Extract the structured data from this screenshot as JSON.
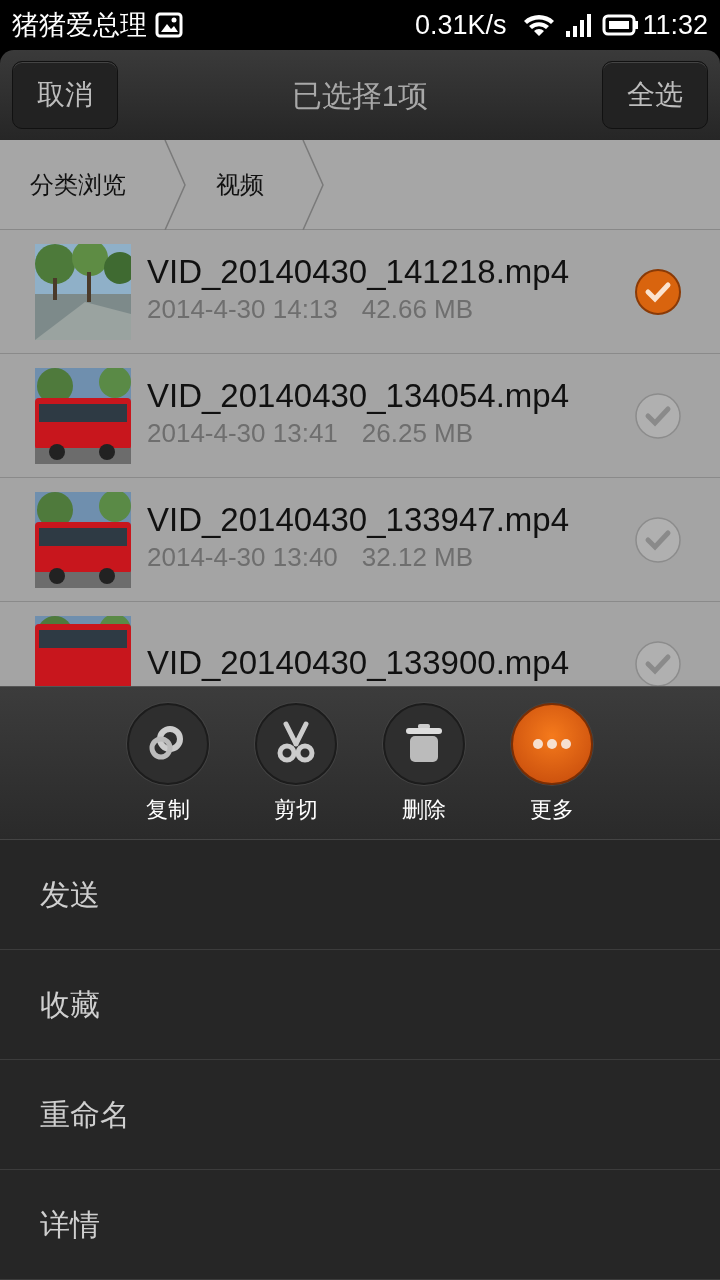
{
  "status_bar": {
    "app_name": "猪猪爱总理",
    "speed": "0.31K/s",
    "time": "11:32"
  },
  "title_bar": {
    "cancel": "取消",
    "title": "已选择1项",
    "select_all": "全选"
  },
  "breadcrumbs": [
    "分类浏览",
    "视频"
  ],
  "files": [
    {
      "name": "VID_20140430_141218.mp4",
      "date": "2014-4-30 14:13",
      "size": "42.66 MB",
      "selected": true
    },
    {
      "name": "VID_20140430_134054.mp4",
      "date": "2014-4-30 13:41",
      "size": "26.25 MB",
      "selected": false
    },
    {
      "name": "VID_20140430_133947.mp4",
      "date": "2014-4-30 13:40",
      "size": "32.12 MB",
      "selected": false
    },
    {
      "name": "VID_20140430_133900.mp4",
      "selected": false
    }
  ],
  "actions": [
    {
      "label": "复制",
      "kind": "copy",
      "highlighted": false
    },
    {
      "label": "剪切",
      "kind": "cut",
      "highlighted": false
    },
    {
      "label": "删除",
      "kind": "delete",
      "highlighted": false
    },
    {
      "label": "更多",
      "kind": "more",
      "highlighted": true
    }
  ],
  "menu": [
    "发送",
    "收藏",
    "重命名",
    "详情"
  ]
}
